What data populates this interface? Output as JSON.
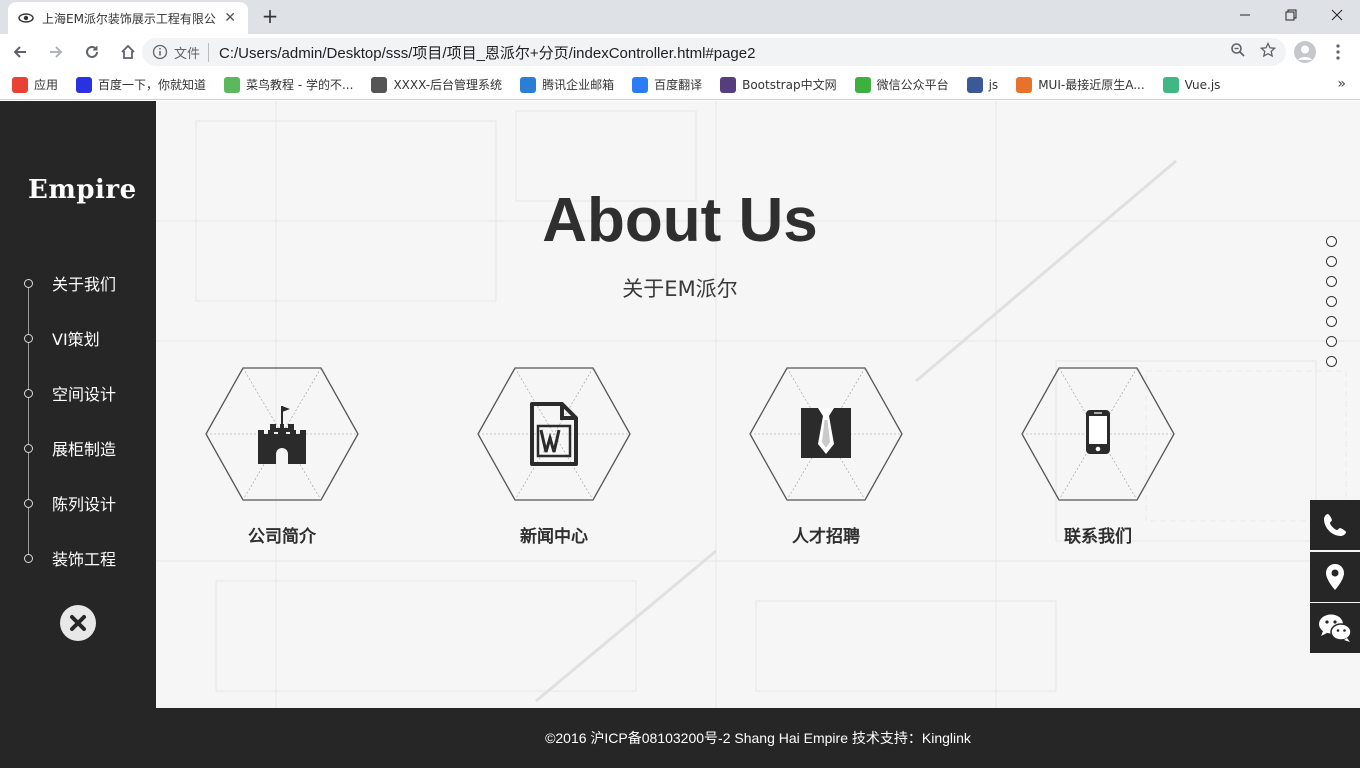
{
  "browser": {
    "tab_title": "上海EM派尔装饰展示工程有限公",
    "omnibox_label": "文件",
    "url": "C:/Users/admin/Desktop/sss/项目/项目_恩派尔+分页/indexController.html#page2",
    "bookmarks": [
      {
        "label": "应用",
        "icon": "apps-grid-icon",
        "color": "#e94235"
      },
      {
        "label": "百度一下，你就知道",
        "icon": "baidu-paw-icon",
        "color": "#2932e1"
      },
      {
        "label": "菜鸟教程 - 学的不...",
        "icon": "runoob-icon",
        "color": "#5cb85c"
      },
      {
        "label": "XXXX-后台管理系统",
        "icon": "globe-icon",
        "color": "#555555"
      },
      {
        "label": "腾讯企业邮箱",
        "icon": "tencent-mail-icon",
        "color": "#2a7fd4"
      },
      {
        "label": "百度翻译",
        "icon": "translate-icon",
        "color": "#2b7cf5"
      },
      {
        "label": "Bootstrap中文网",
        "icon": "bootstrap-icon",
        "color": "#563d7c"
      },
      {
        "label": "微信公众平台",
        "icon": "wechat-icon",
        "color": "#3db13d"
      },
      {
        "label": "js",
        "icon": "facebook-icon",
        "color": "#3b5998"
      },
      {
        "label": "MUI-最接近原生A...",
        "icon": "mui-icon",
        "color": "#e8712c"
      },
      {
        "label": "Vue.js",
        "icon": "vue-icon",
        "color": "#41b883"
      }
    ]
  },
  "sidebar": {
    "logo": "Empire",
    "items": [
      {
        "label": "关于我们"
      },
      {
        "label": "VI策划"
      },
      {
        "label": "空间设计"
      },
      {
        "label": "展柜制造"
      },
      {
        "label": "陈列设计"
      },
      {
        "label": "装饰工程"
      }
    ]
  },
  "main": {
    "title": "About Us",
    "subtitle": "关于EM派尔",
    "cards": [
      {
        "label": "公司简介",
        "icon": "castle-icon"
      },
      {
        "label": "新闻中心",
        "icon": "word-document-icon"
      },
      {
        "label": "人才招聘",
        "icon": "tie-icon"
      },
      {
        "label": "联系我们",
        "icon": "smartphone-icon"
      }
    ],
    "page_dots": 7
  },
  "side_tools": [
    "phone-icon",
    "location-pin-icon",
    "wechat-icon"
  ],
  "footer": {
    "text": "©2016  沪ICP备08103200号-2 Shang  Hai  Empire  技术支持：Kinglink"
  },
  "colors": {
    "sidebar_bg": "#262626",
    "main_bg": "#f5f5f5",
    "text_dark": "#2f2f2f"
  }
}
